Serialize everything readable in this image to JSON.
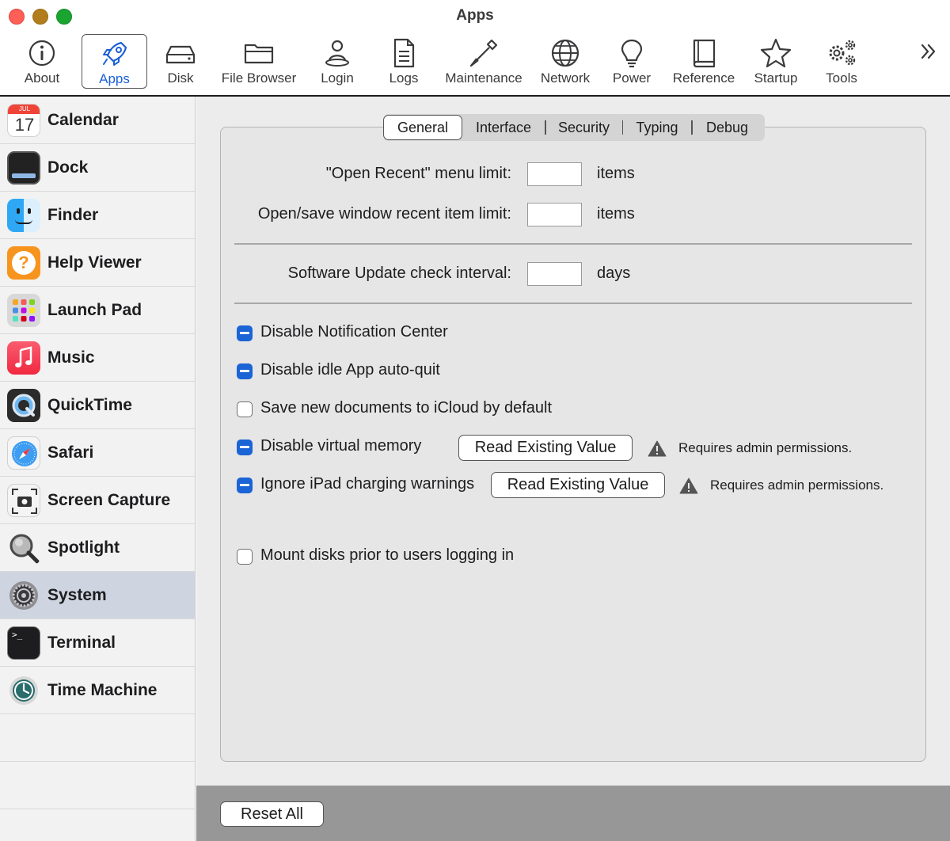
{
  "window": {
    "title": "Apps"
  },
  "toolbar": {
    "items": [
      {
        "label": "About",
        "icon": "info-icon"
      },
      {
        "label": "Apps",
        "icon": "rocket-icon",
        "active": true
      },
      {
        "label": "Disk",
        "icon": "disk-icon"
      },
      {
        "label": "File Browser",
        "icon": "folder-icon"
      },
      {
        "label": "Login",
        "icon": "user-icon"
      },
      {
        "label": "Logs",
        "icon": "document-icon"
      },
      {
        "label": "Maintenance",
        "icon": "screwdriver-icon"
      },
      {
        "label": "Network",
        "icon": "globe-icon"
      },
      {
        "label": "Power",
        "icon": "lightbulb-icon"
      },
      {
        "label": "Reference",
        "icon": "book-icon"
      },
      {
        "label": "Startup",
        "icon": "star-icon"
      },
      {
        "label": "Tools",
        "icon": "gears-icon"
      }
    ],
    "overflow_icon": "chevron-double-right-icon",
    "accent_color": "#1a5fd6"
  },
  "sidebar": {
    "items": [
      {
        "label": "Calendar",
        "icon": "calendar-icon",
        "icon_month": "JUL",
        "icon_day": "17"
      },
      {
        "label": "Dock",
        "icon": "dock-icon"
      },
      {
        "label": "Finder",
        "icon": "finder-icon"
      },
      {
        "label": "Help Viewer",
        "icon": "help-icon"
      },
      {
        "label": "Launch Pad",
        "icon": "launchpad-icon"
      },
      {
        "label": "Music",
        "icon": "music-icon"
      },
      {
        "label": "QuickTime",
        "icon": "quicktime-icon"
      },
      {
        "label": "Safari",
        "icon": "safari-icon"
      },
      {
        "label": "Screen Capture",
        "icon": "screenshot-icon"
      },
      {
        "label": "Spotlight",
        "icon": "magnifier-icon"
      },
      {
        "label": "System",
        "icon": "system-settings-icon",
        "selected": true
      },
      {
        "label": "Terminal",
        "icon": "terminal-icon",
        "icon_text": ">_"
      },
      {
        "label": "Time Machine",
        "icon": "time-machine-icon"
      }
    ]
  },
  "tabs": [
    {
      "label": "General",
      "active": true
    },
    {
      "label": "Interface"
    },
    {
      "label": "Security"
    },
    {
      "label": "Typing"
    },
    {
      "label": "Debug"
    }
  ],
  "fields": {
    "open_recent": {
      "label": "\"Open Recent\" menu limit:",
      "value": "",
      "unit": "items"
    },
    "open_save_recent": {
      "label": "Open/save window recent item limit:",
      "value": "",
      "unit": "items"
    },
    "software_update": {
      "label": "Software Update check interval:",
      "value": "",
      "unit": "days"
    }
  },
  "options": [
    {
      "label": "Disable Notification Center",
      "state": "mixed"
    },
    {
      "label": "Disable idle App auto-quit",
      "state": "mixed"
    },
    {
      "label": "Save new documents to iCloud by default",
      "state": "off"
    },
    {
      "label": "Disable virtual memory",
      "state": "mixed",
      "button": "Read Existing Value",
      "note": "Requires admin permissions."
    },
    {
      "label": "Ignore iPad charging warnings",
      "state": "mixed",
      "button": "Read Existing Value",
      "note": "Requires admin permissions."
    },
    {
      "label": "Mount disks prior to users logging in",
      "state": "off"
    }
  ],
  "footer": {
    "reset_label": "Reset All"
  },
  "colors": {
    "checkbox_mixed": "#1a64d6",
    "sidebar_selected": "#cfd5e0",
    "footer_bg": "#979797"
  }
}
